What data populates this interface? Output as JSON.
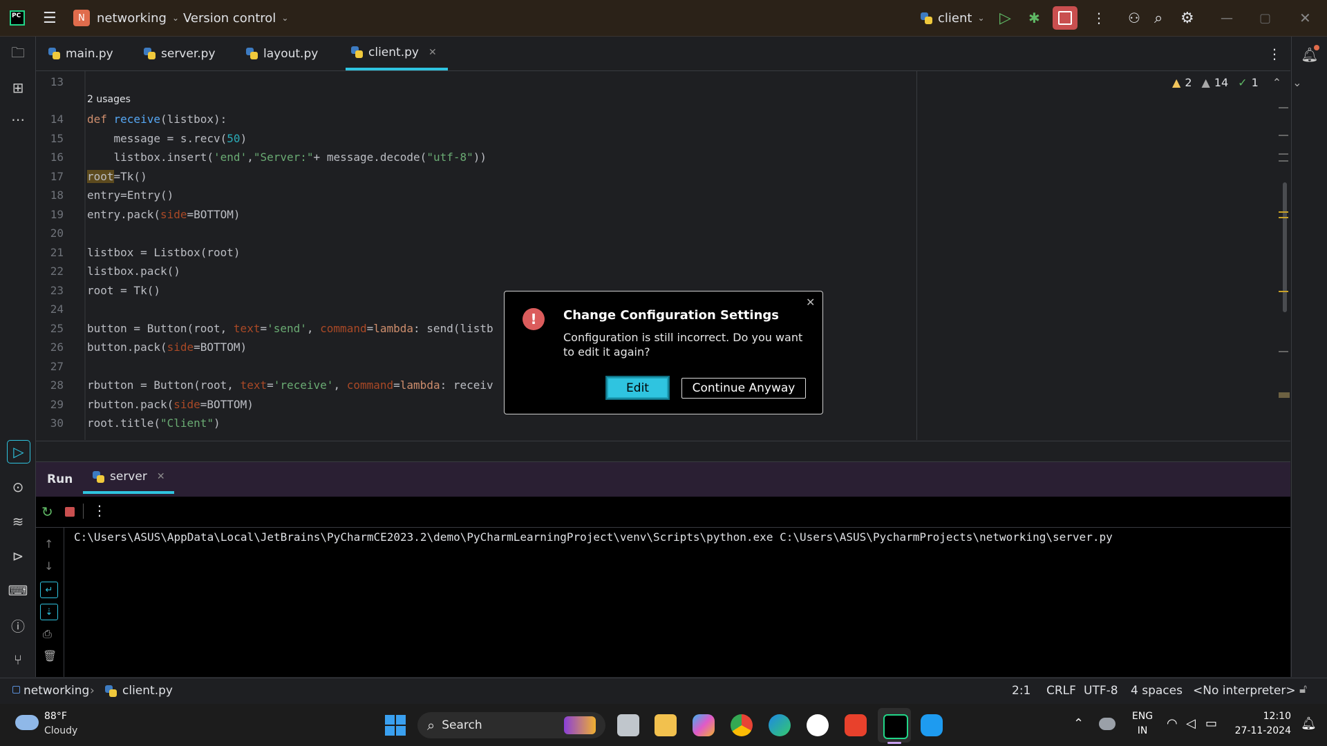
{
  "titlebar": {
    "app_logo": "PC",
    "project_badge": "N",
    "project_name": "networking",
    "vcs": "Version control",
    "run_config": "client"
  },
  "tabs": [
    {
      "label": "main.py",
      "active": false
    },
    {
      "label": "server.py",
      "active": false
    },
    {
      "label": "layout.py",
      "active": false
    },
    {
      "label": "client.py",
      "active": true
    }
  ],
  "inspections": {
    "warnings": "2",
    "weak_warnings": "14",
    "ok": "1"
  },
  "editor": {
    "usages_hint": "2 usages",
    "lines": [
      "13",
      "14",
      "15",
      "16",
      "17",
      "18",
      "19",
      "20",
      "21",
      "22",
      "23",
      "24",
      "25",
      "26",
      "27",
      "28",
      "29",
      "30"
    ]
  },
  "dialog": {
    "title": "Change Configuration Settings",
    "message": "Configuration is still incorrect. Do you want to edit it again?",
    "primary_button": "Edit",
    "secondary_button": "Continue Anyway"
  },
  "run_panel": {
    "title": "Run",
    "tab_label": "server",
    "command": "C:\\Users\\ASUS\\AppData\\Local\\JetBrains\\PyCharmCE2023.2\\demo\\PyCharmLearningProject\\venv\\Scripts\\python.exe C:\\Users\\ASUS\\PycharmProjects\\networking\\server.py"
  },
  "statusbar": {
    "project": "networking",
    "file": "client.py",
    "position": "2:1",
    "line_sep": "CRLF",
    "encoding": "UTF-8",
    "indent": "4 spaces",
    "interpreter": "<No interpreter>"
  },
  "taskbar": {
    "weather_temp": "88°F",
    "weather_desc": "Cloudy",
    "search_placeholder": "Search",
    "lang_line1": "ENG",
    "lang_line2": "IN",
    "time": "12:10",
    "date": "27-11-2024"
  },
  "colors": {
    "accent": "#2fc4e0",
    "stop_red": "#c94f4f",
    "error_red": "#db5c5c"
  }
}
